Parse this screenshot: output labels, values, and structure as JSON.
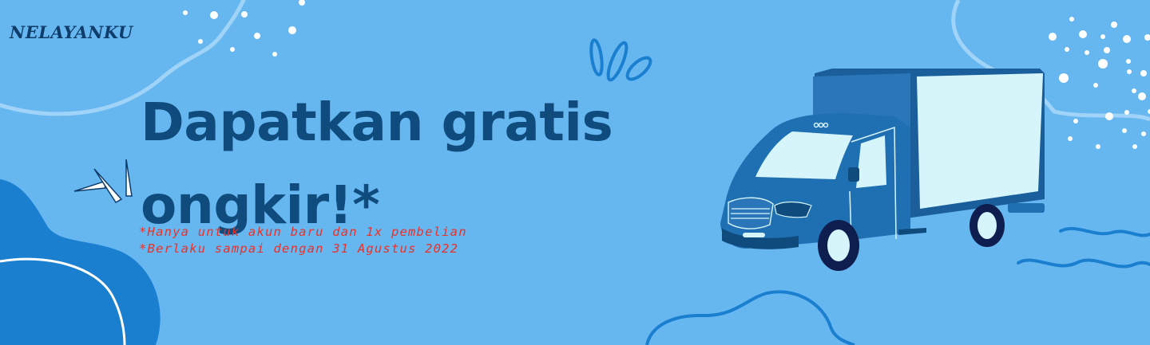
{
  "brand": {
    "name": "NELAYANKU"
  },
  "promo": {
    "headline_line1": "Dapatkan gratis",
    "headline_line2": "ongkir!*",
    "footnotes": [
      "*Hanya untuk akun baru dan 1x pembelian",
      "*Berlaku sampai dengan 31 Agustus 2022"
    ]
  },
  "colors": {
    "background": "#66b6f0",
    "headline": "#0f4c7d",
    "footnote": "#e8322a",
    "truck_body": "#1f6fb3",
    "truck_cargo": "#d6f5fb"
  },
  "illustration": {
    "name": "delivery-truck-icon"
  }
}
